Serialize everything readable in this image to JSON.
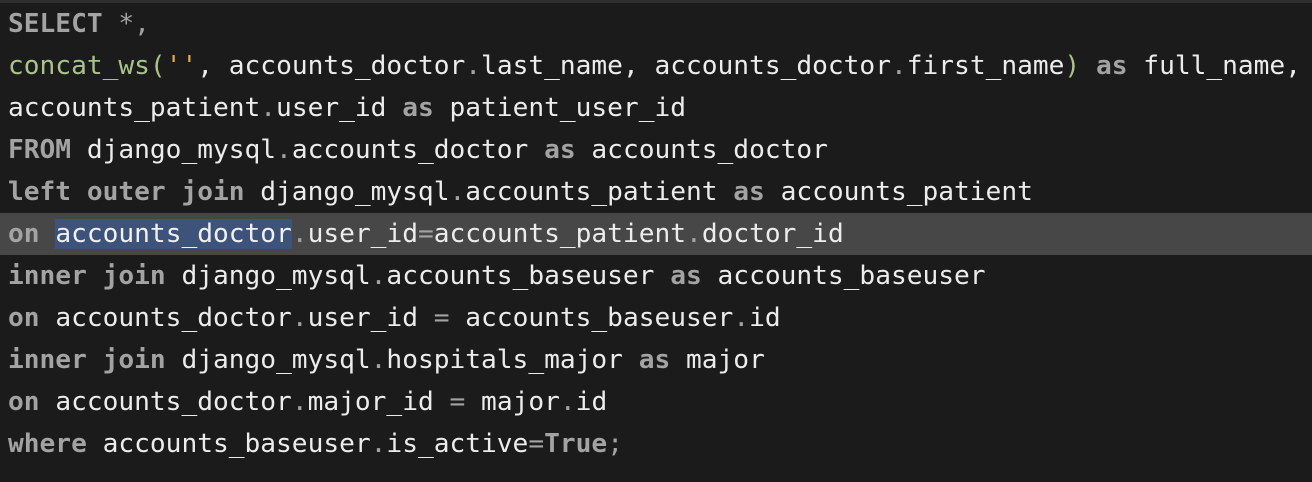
{
  "editor": {
    "language": "sql",
    "current_line": 6,
    "selection": "accounts_doctor",
    "colors": {
      "background": "#1b1b1b",
      "current_line": "#474747",
      "selection": "#3e5379",
      "keyword": "#a3a3a3",
      "function": "#a9c38a",
      "string": "#e8a84a",
      "identifier": "#ececec"
    },
    "lines": [
      [
        {
          "t": "SELECT",
          "c": "kw"
        },
        {
          "t": " ",
          "c": "id"
        },
        {
          "t": "*,",
          "c": "punc"
        }
      ],
      [
        {
          "t": "concat_ws",
          "c": "fn"
        },
        {
          "t": "(",
          "c": "fn"
        },
        {
          "t": "''",
          "c": "str"
        },
        {
          "t": ", accounts_doctor",
          "c": "id"
        },
        {
          "t": ".",
          "c": "punc"
        },
        {
          "t": "last_name, accounts_doctor",
          "c": "id"
        },
        {
          "t": ".",
          "c": "punc"
        },
        {
          "t": "first_name",
          "c": "id"
        },
        {
          "t": ")",
          "c": "fn"
        },
        {
          "t": " ",
          "c": "id"
        },
        {
          "t": "as",
          "c": "kw"
        },
        {
          "t": " full_name,",
          "c": "id"
        }
      ],
      [
        {
          "t": "accounts_patient",
          "c": "id"
        },
        {
          "t": ".",
          "c": "punc"
        },
        {
          "t": "user_id ",
          "c": "id"
        },
        {
          "t": "as",
          "c": "kw"
        },
        {
          "t": " patient_user_id",
          "c": "id"
        }
      ],
      [
        {
          "t": "FROM",
          "c": "kw"
        },
        {
          "t": " django_mysql",
          "c": "id"
        },
        {
          "t": ".",
          "c": "punc"
        },
        {
          "t": "accounts_doctor ",
          "c": "id"
        },
        {
          "t": "as",
          "c": "kw"
        },
        {
          "t": " accounts_doctor",
          "c": "id"
        }
      ],
      [
        {
          "t": "left outer join",
          "c": "kw"
        },
        {
          "t": " django_mysql",
          "c": "id"
        },
        {
          "t": ".",
          "c": "punc"
        },
        {
          "t": "accounts_patient ",
          "c": "id"
        },
        {
          "t": "as",
          "c": "kw"
        },
        {
          "t": " accounts_patient",
          "c": "id"
        }
      ],
      [
        {
          "t": "on",
          "c": "kw"
        },
        {
          "t": " ",
          "c": "id"
        },
        {
          "t": "accounts_doctor",
          "c": "sel"
        },
        {
          "t": ".",
          "c": "punc"
        },
        {
          "t": "user_id",
          "c": "id"
        },
        {
          "t": "=",
          "c": "punc"
        },
        {
          "t": "accounts_patient",
          "c": "id"
        },
        {
          "t": ".",
          "c": "punc"
        },
        {
          "t": "doctor_id",
          "c": "id"
        }
      ],
      [
        {
          "t": "inner join",
          "c": "kw"
        },
        {
          "t": " django_mysql",
          "c": "id"
        },
        {
          "t": ".",
          "c": "punc"
        },
        {
          "t": "accounts_baseuser ",
          "c": "id"
        },
        {
          "t": "as",
          "c": "kw"
        },
        {
          "t": " accounts_baseuser",
          "c": "id"
        }
      ],
      [
        {
          "t": "on",
          "c": "kw"
        },
        {
          "t": " accounts_doctor",
          "c": "id"
        },
        {
          "t": ".",
          "c": "punc"
        },
        {
          "t": "user_id ",
          "c": "id"
        },
        {
          "t": "=",
          "c": "punc"
        },
        {
          "t": " accounts_baseuser",
          "c": "id"
        },
        {
          "t": ".",
          "c": "punc"
        },
        {
          "t": "id",
          "c": "id"
        }
      ],
      [
        {
          "t": "inner join",
          "c": "kw"
        },
        {
          "t": " django_mysql",
          "c": "id"
        },
        {
          "t": ".",
          "c": "punc"
        },
        {
          "t": "hospitals_major ",
          "c": "id"
        },
        {
          "t": "as",
          "c": "kw"
        },
        {
          "t": " major",
          "c": "id"
        }
      ],
      [
        {
          "t": "on",
          "c": "kw"
        },
        {
          "t": " accounts_doctor",
          "c": "id"
        },
        {
          "t": ".",
          "c": "punc"
        },
        {
          "t": "major_id ",
          "c": "id"
        },
        {
          "t": "=",
          "c": "punc"
        },
        {
          "t": " major",
          "c": "id"
        },
        {
          "t": ".",
          "c": "punc"
        },
        {
          "t": "id",
          "c": "id"
        }
      ],
      [
        {
          "t": "where",
          "c": "kw"
        },
        {
          "t": " accounts_baseuser",
          "c": "id"
        },
        {
          "t": ".",
          "c": "punc"
        },
        {
          "t": "is_active",
          "c": "id"
        },
        {
          "t": "=",
          "c": "punc"
        },
        {
          "t": "True",
          "c": "kw"
        },
        {
          "t": ";",
          "c": "punc"
        }
      ]
    ]
  }
}
